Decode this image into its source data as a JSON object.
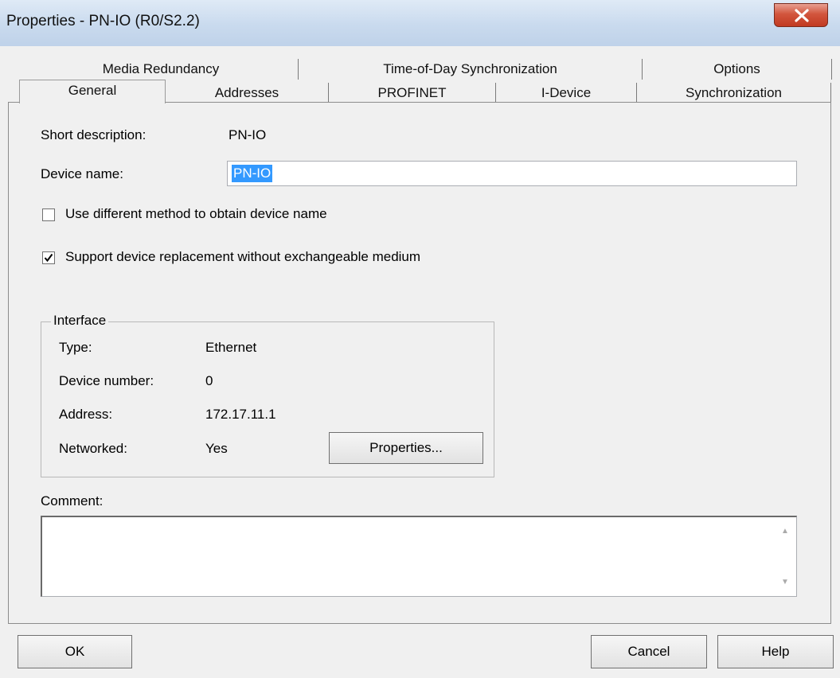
{
  "window": {
    "title": "Properties - PN-IO (R0/S2.2)"
  },
  "tabs": {
    "row1": [
      "Media Redundancy",
      "Time-of-Day Synchronization",
      "Options"
    ],
    "row2": [
      "General",
      "Addresses",
      "PROFINET",
      "I-Device",
      "Synchronization"
    ]
  },
  "general": {
    "short_description_label": "Short description:",
    "short_description_value": "PN-IO",
    "device_name_label": "Device name:",
    "device_name_value": "PN-IO",
    "use_different_method_label": "Use different method to obtain device name",
    "use_different_method_checked": false,
    "support_replacement_label": "Support device replacement without exchangeable medium",
    "support_replacement_checked": true
  },
  "interface": {
    "legend": "Interface",
    "type_label": "Type:",
    "type_value": "Ethernet",
    "device_number_label": "Device number:",
    "device_number_value": "0",
    "address_label": "Address:",
    "address_value": "172.17.11.1",
    "networked_label": "Networked:",
    "networked_value": "Yes",
    "properties_button": "Properties..."
  },
  "comment": {
    "label": "Comment:",
    "value": ""
  },
  "buttons": {
    "ok": "OK",
    "cancel": "Cancel",
    "help": "Help"
  }
}
